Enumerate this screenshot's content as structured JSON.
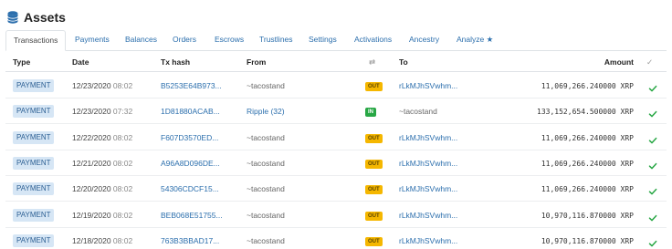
{
  "header": {
    "title": "Assets",
    "icon": "database-icon"
  },
  "tabs": [
    {
      "label": "Transactions",
      "active": true
    },
    {
      "label": "Payments"
    },
    {
      "label": "Balances"
    },
    {
      "label": "Orders"
    },
    {
      "label": "Escrows"
    },
    {
      "label": "Trustlines"
    },
    {
      "label": "Settings"
    },
    {
      "label": "Activations"
    },
    {
      "label": "Ancestry"
    },
    {
      "label": "Analyze ★"
    }
  ],
  "table": {
    "columns": {
      "type": "Type",
      "date": "Date",
      "hash": "Tx hash",
      "from": "From",
      "direction_icon": "⇄",
      "to": "To",
      "amount": "Amount",
      "status_icon": "✓"
    },
    "rows": [
      {
        "type": "PAYMENT",
        "date": "12/23/2020",
        "time": "08:02",
        "hash": "B5253E64B973...",
        "from": "~tacostand",
        "direction": "OUT",
        "to": "rLkMJhSVwhm...",
        "amount": "11,069,266.240000 XRP"
      },
      {
        "type": "PAYMENT",
        "date": "12/23/2020",
        "time": "07:32",
        "hash": "1D81880ACAB...",
        "from": "Ripple (32)",
        "direction": "IN",
        "to": "~tacostand",
        "amount": "133,152,654.500000 XRP"
      },
      {
        "type": "PAYMENT",
        "date": "12/22/2020",
        "time": "08:02",
        "hash": "F607D3570ED...",
        "from": "~tacostand",
        "direction": "OUT",
        "to": "rLkMJhSVwhm...",
        "amount": "11,069,266.240000 XRP"
      },
      {
        "type": "PAYMENT",
        "date": "12/21/2020",
        "time": "08:02",
        "hash": "A96A8D096DE...",
        "from": "~tacostand",
        "direction": "OUT",
        "to": "rLkMJhSVwhm...",
        "amount": "11,069,266.240000 XRP"
      },
      {
        "type": "PAYMENT",
        "date": "12/20/2020",
        "time": "08:02",
        "hash": "54306CDCF15...",
        "from": "~tacostand",
        "direction": "OUT",
        "to": "rLkMJhSVwhm...",
        "amount": "11,069,266.240000 XRP"
      },
      {
        "type": "PAYMENT",
        "date": "12/19/2020",
        "time": "08:02",
        "hash": "BEB068E51755...",
        "from": "~tacostand",
        "direction": "OUT",
        "to": "rLkMJhSVwhm...",
        "amount": "10,970,116.870000 XRP"
      },
      {
        "type": "PAYMENT",
        "date": "12/18/2020",
        "time": "08:02",
        "hash": "763B3BBAD17...",
        "from": "~tacostand",
        "direction": "OUT",
        "to": "rLkMJhSVwhm...",
        "amount": "10,970,116.870000 XRP"
      }
    ]
  },
  "colors": {
    "link": "#2c6fad",
    "out_badge": "#f5b700",
    "in_badge": "#28a745",
    "check": "#28a745",
    "type_badge": "#d6e6f5"
  }
}
